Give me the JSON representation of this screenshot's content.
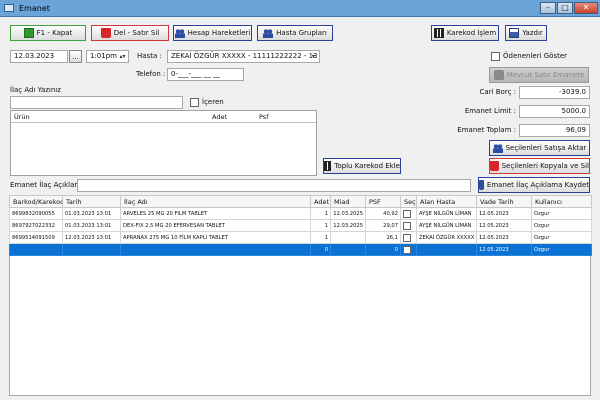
{
  "window": {
    "title": "Emanet",
    "minimize": "–",
    "maximize": "□",
    "close": "✕"
  },
  "toolbar": {
    "close_label": "F1 - Kapat",
    "delete_label": "Del - Satır Sil",
    "account_moves_label": "Hesap Hareketleri",
    "patient_groups_label": "Hasta Grupları",
    "barcode_process_label": "Karekod İşlem",
    "print_label": "Yazdır"
  },
  "form": {
    "date_value": "12.03.2023",
    "date_picker_label": "...",
    "time_value": "1:01pm",
    "patient_label": "Hasta :",
    "patient_value": "ZEKAİ ÖZGÜR XXXXX - 11111222222 - 13",
    "phone_label": "Telefon :",
    "phone_value": "0-___-___ __ __",
    "show_paid_label": "Ödenenleri Göster",
    "current_row_escrow_label": "Mevcut Satır Emanete",
    "drug_name_label": "İlaç Adı Yazınız",
    "contains_label": "İçeren",
    "bulk_barcode_label": "Toplu Karekod Ekle",
    "balance_label": "Cari Borç :",
    "balance_value": "-3039.0",
    "escrow_limit_label": "Emanet Limit :",
    "escrow_limit_value": "5000.0",
    "escrow_total_label": "Emanet Toplam :",
    "escrow_total_value": "96,09",
    "transfer_to_sale_label": "Seçilenleri Satışa Aktar",
    "copy_delete_label": "Seçilenleri Kopyala ve Sil",
    "escrow_note_label": "Emanet İlaç Açıklama",
    "save_note_label": "Emanet İlaç Açıklama Kaydet"
  },
  "product_list": {
    "columns": [
      "Ürün",
      "Adet",
      "Psf"
    ]
  },
  "grid": {
    "columns": [
      "Barkod/Karekod",
      "Tarih",
      "İlaç Adı",
      "Adet",
      "Miad",
      "PSF",
      "Seç",
      "Alan Hasta",
      "Vade Tarih",
      "Kullanıcı"
    ],
    "rows": [
      [
        "8699832090055",
        "01.03.2023 13:01",
        "ARVELES 25 MG 20 FILM TABLET",
        "1",
        "12.03.2025",
        "40,92",
        "",
        "AYŞE NİLGÜN LİMAN",
        "12.05.2023",
        "Ozgur"
      ],
      [
        "8697927022332",
        "01.03.2023 13:01",
        "DEX-FIX 2,5 MG 20 EFERVESAN TABLET",
        "1",
        "12.03.2025",
        "29,07",
        "",
        "AYŞE NİLGÜN LİMAN",
        "12.05.2023",
        "Ozgur"
      ],
      [
        "8699514091509",
        "12.03.2023 13:01",
        "APRANAX 275 MG 10 FİLM KAPLI TABLET",
        "1",
        "",
        "26,1",
        "",
        "ZEKAİ ÖZGÜR XXXXX",
        "12.05.2023",
        "Ozgur"
      ],
      [
        "",
        "",
        "",
        "0",
        "",
        "0",
        "",
        "",
        "12.05.2023",
        "Ozgur"
      ]
    ]
  },
  "colors": {
    "selected_row": "#0a72d4",
    "title_bar": "#6aa3d8"
  }
}
